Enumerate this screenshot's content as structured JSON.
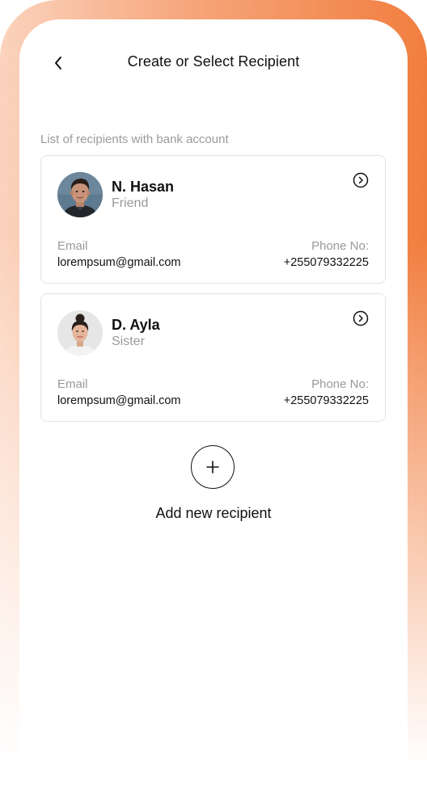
{
  "header": {
    "title": "Create or Select Recipient",
    "back_icon": "chevron-left-icon"
  },
  "section_label": "List of recipients with bank account",
  "recipients": [
    {
      "name": "N. Hasan",
      "relation": "Friend",
      "email_label": "Email",
      "email": "lorempsum@gmail.com",
      "phone_label": "Phone No:",
      "phone": "+255079332225",
      "action_icon": "chevron-right-circle-icon"
    },
    {
      "name": "D. Ayla",
      "relation": "Sister",
      "email_label": "Email",
      "email": "lorempsum@gmail.com",
      "phone_label": "Phone No:",
      "phone": "+255079332225",
      "action_icon": "chevron-right-circle-icon"
    }
  ],
  "add_new": {
    "label": "Add new recipient",
    "icon": "plus-icon"
  },
  "colors": {
    "frame_gradient_start": "#fbd3bd",
    "frame_gradient_end": "#f17e3f",
    "text_primary": "#111111",
    "text_secondary": "#9a9a9a",
    "card_border": "#e4e4e4"
  }
}
